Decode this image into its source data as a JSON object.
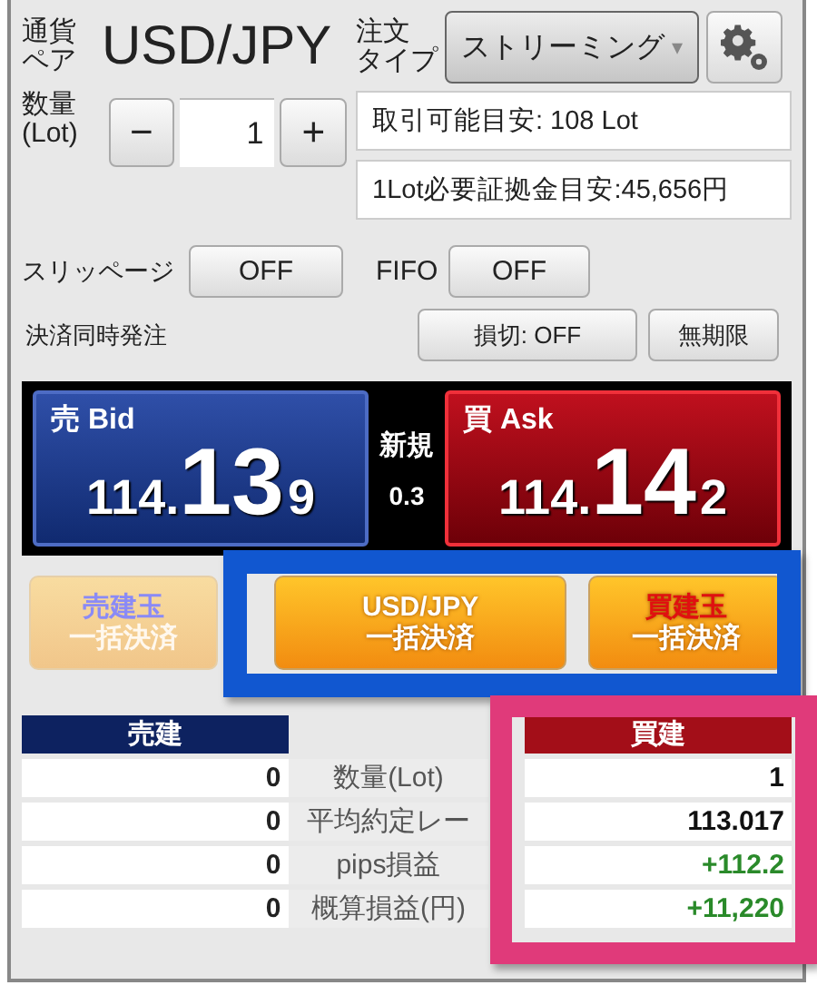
{
  "pair": {
    "label": [
      "通貨",
      "ペア"
    ],
    "value": "USD/JPY"
  },
  "order_type": {
    "label": [
      "注文",
      "タイプ"
    ],
    "value": "ストリーミング",
    "caret": "▾"
  },
  "quantity": {
    "label": [
      "数量",
      "(Lot)"
    ],
    "minus": "−",
    "value": "1",
    "plus": "+"
  },
  "info": [
    "取引可能目安:  108 Lot",
    "1Lot必要証拠金目安:45,656円"
  ],
  "slippage": {
    "label": "スリッページ",
    "button": "OFF"
  },
  "fifo": {
    "label": "FIFO",
    "button": "OFF"
  },
  "settle": {
    "label": "決済同時発注",
    "buttons": [
      "損切: OFF",
      "無期限"
    ]
  },
  "quotes": [
    {
      "kind": "bid",
      "label": "売 Bid",
      "head": "114.",
      "big": "13",
      "tail": "9"
    },
    {
      "kind": "ask",
      "label": "買 Ask",
      "head": "114.",
      "big": "14",
      "tail": "2"
    }
  ],
  "spread": {
    "label": "新規",
    "value": "0.3"
  },
  "close_buttons": [
    {
      "kind": "sell",
      "lines": [
        "売建玉",
        "一括決済"
      ],
      "disabled": true
    },
    {
      "kind": "pair",
      "lines": [
        "USD/JPY",
        "一括決済"
      ],
      "disabled": false
    },
    {
      "kind": "buy",
      "lines": [
        "買建玉",
        "一括決済"
      ],
      "disabled": false
    }
  ],
  "positions": {
    "sell_header": "売建",
    "buy_header": "買建",
    "rows": [
      {
        "sell": "0",
        "label": "数量(Lot)",
        "buy": "1",
        "color": "#111111"
      },
      {
        "sell": "0",
        "label": "平均約定レー",
        "buy": "113.017",
        "color": "#111111"
      },
      {
        "sell": "0",
        "label": "pips損益",
        "buy": "+112.2",
        "color": "#2a8a2a"
      },
      {
        "sell": "0",
        "label": "概算損益(円)",
        "buy": "+11,220",
        "color": "#2a8a2a"
      }
    ]
  },
  "highlights": [
    {
      "kind": "actions",
      "color": "#1157d0"
    },
    {
      "kind": "positions",
      "color": "#e03a7a"
    }
  ]
}
